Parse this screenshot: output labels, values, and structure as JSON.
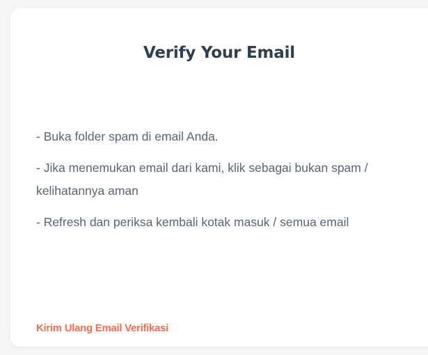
{
  "card": {
    "title": "Verify Your Email",
    "steps": [
      "- Buka folder spam di email Anda.",
      "- Jika menemukan email dari kami, klik sebagai bukan spam / kelihatannya aman",
      "- Refresh dan periksa kembali kotak masuk / semua email"
    ],
    "resend_link": "Kirim Ulang Email Verifikasi"
  },
  "colors": {
    "background": "#f4f5f7",
    "card": "#ffffff",
    "title": "#2f3e4e",
    "text": "#5a6573",
    "accent": "#f26d4f"
  }
}
